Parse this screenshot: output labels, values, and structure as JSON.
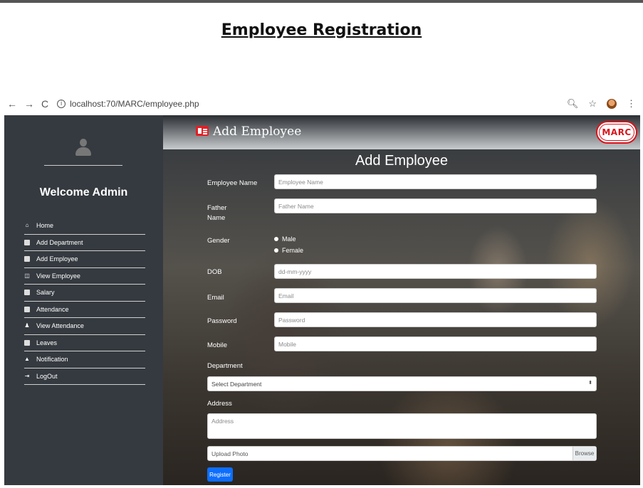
{
  "doc": {
    "title": "Employee Registration"
  },
  "browser": {
    "back": "←",
    "forward": "→",
    "reload": "C",
    "url": "localhost:70/MARC/employee.php",
    "zoom_icon": "zoom-icon",
    "star_icon": "star-icon",
    "menu_icon": "kebab-menu-icon"
  },
  "sidebar": {
    "welcome": "Welcome Admin",
    "items": [
      {
        "label": "Home",
        "icon": "home-icon"
      },
      {
        "label": "Add Department",
        "icon": "department-icon"
      },
      {
        "label": "Add Employee",
        "icon": "id-card-icon"
      },
      {
        "label": "View Employee",
        "icon": "view-icon"
      },
      {
        "label": "Salary",
        "icon": "money-icon"
      },
      {
        "label": "Attendance",
        "icon": "calendar-icon"
      },
      {
        "label": "View Attendance",
        "icon": "user-check-icon"
      },
      {
        "label": "Leaves",
        "icon": "leave-icon"
      },
      {
        "label": "Notification",
        "icon": "bell-icon"
      },
      {
        "label": "LogOut",
        "icon": "logout-icon"
      }
    ]
  },
  "header": {
    "title": "Add Employee",
    "logo": "MARC"
  },
  "form": {
    "title": "Add Employee",
    "employee_name": {
      "label": "Employee Name",
      "placeholder": "Employee Name"
    },
    "father_name": {
      "label": "Father Name",
      "placeholder": "Father Name"
    },
    "gender": {
      "label": "Gender",
      "options": [
        "Male",
        "Female"
      ]
    },
    "dob": {
      "label": "DOB",
      "placeholder": "dd-mm-yyyy"
    },
    "email": {
      "label": "Email",
      "placeholder": "Email"
    },
    "password": {
      "label": "Password",
      "placeholder": "Password"
    },
    "mobile": {
      "label": "Mobile",
      "placeholder": "Mobile"
    },
    "department": {
      "label": "Department",
      "selected": "Select Department"
    },
    "address": {
      "label": "Address",
      "placeholder": "Address"
    },
    "photo": {
      "placeholder": "Upload Photo",
      "browse": "Browse"
    },
    "register": "Register"
  },
  "colors": {
    "accent": "#0d6efd",
    "brand": "#d8141c",
    "sidebar": "#353a40"
  }
}
